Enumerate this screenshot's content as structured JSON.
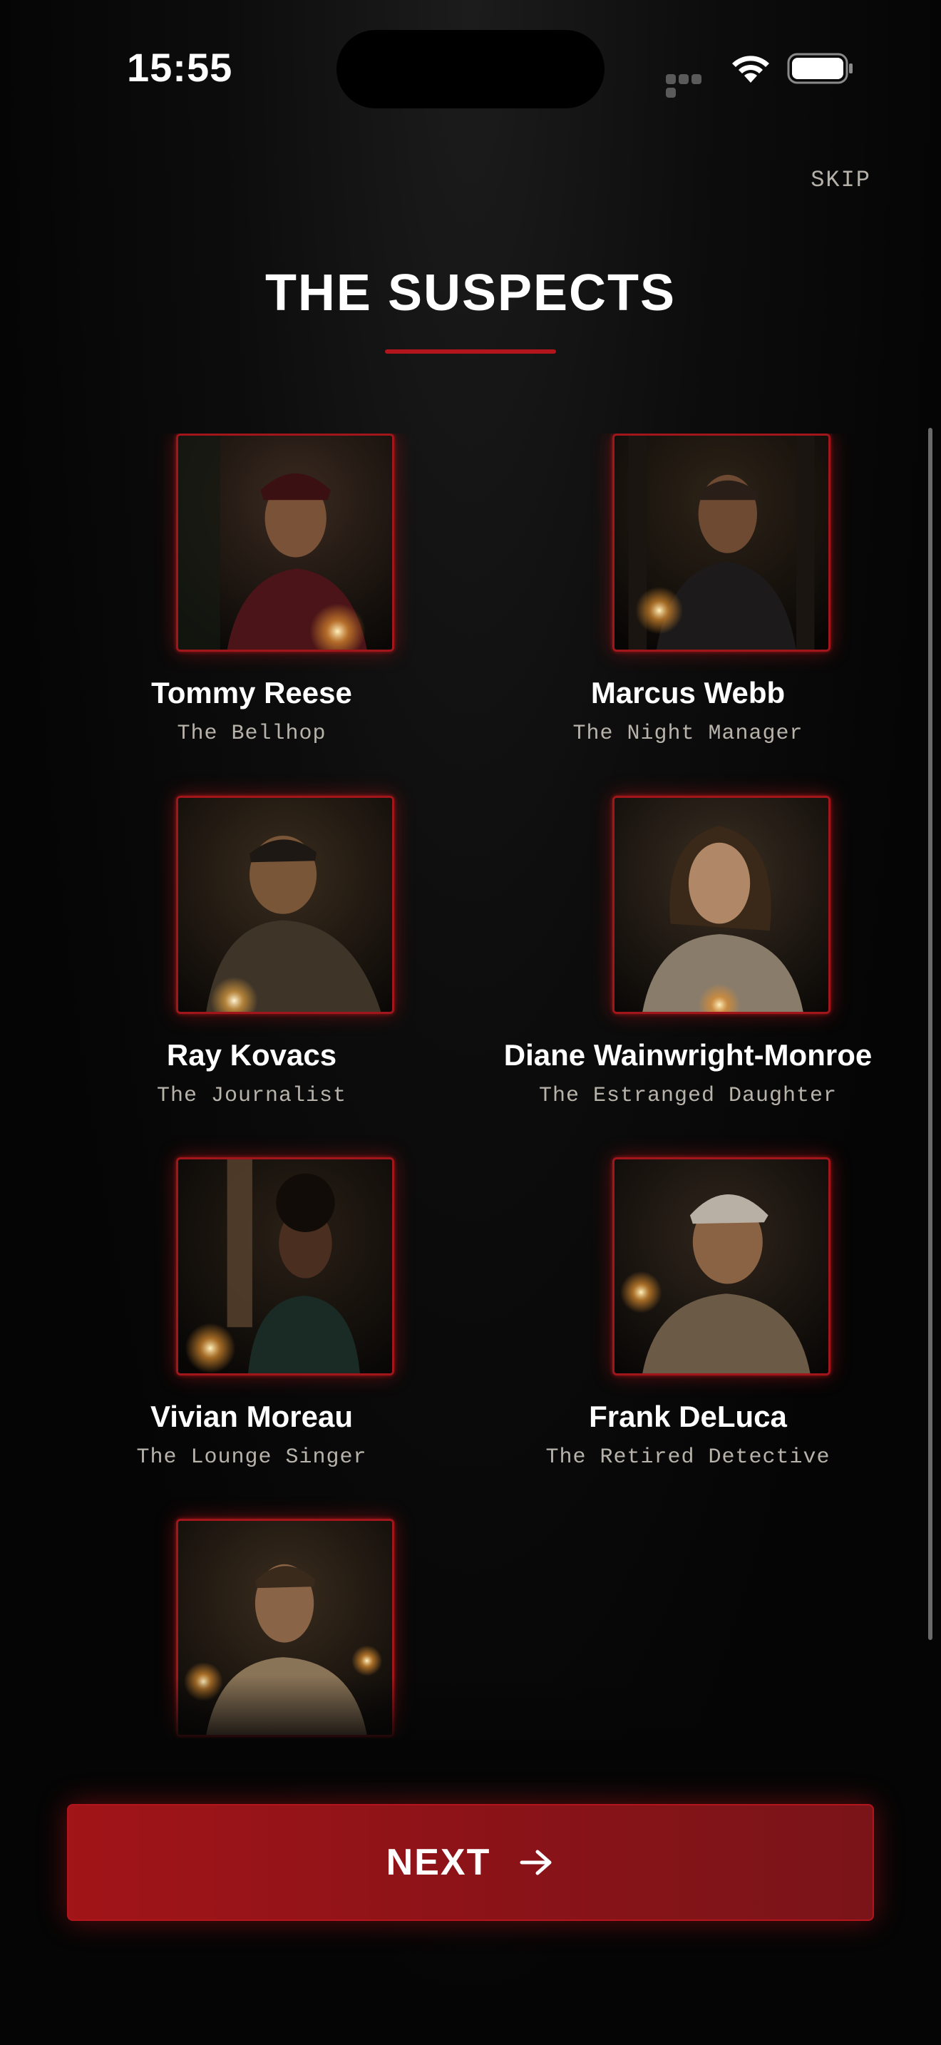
{
  "status_bar": {
    "time": "15:55"
  },
  "header": {
    "skip_label": "SKIP",
    "title": "THE SUSPECTS"
  },
  "suspects": [
    {
      "name": "Tommy Reese",
      "role": "The Bellhop"
    },
    {
      "name": "Marcus Webb",
      "role": "The Night Manager"
    },
    {
      "name": "Ray Kovacs",
      "role": "The Journalist"
    },
    {
      "name": "Diane Wainwright-Monroe",
      "role": "The Estranged Daughter"
    },
    {
      "name": "Vivian Moreau",
      "role": "The Lounge Singer"
    },
    {
      "name": "Frank DeLuca",
      "role": "The Retired Detective"
    },
    {
      "name": "",
      "role": ""
    }
  ],
  "footer": {
    "next_label": "NEXT"
  },
  "colors": {
    "accent": "#b3151c",
    "background": "#050505",
    "muted_text": "#b7b2aa"
  },
  "icons": [
    "wifi-icon",
    "battery-icon",
    "arrow-right-icon"
  ]
}
